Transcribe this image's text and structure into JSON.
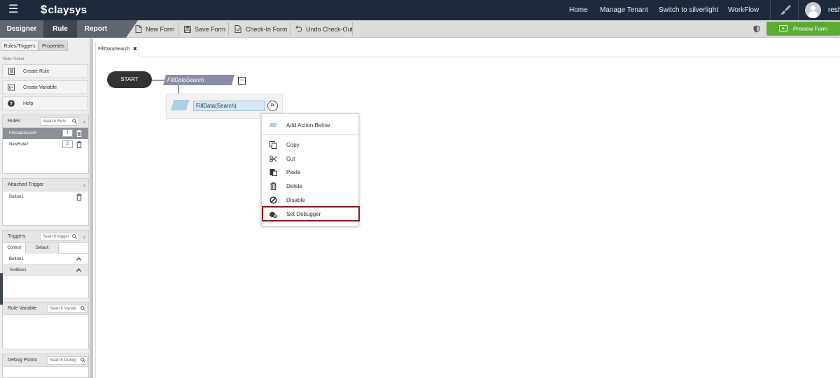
{
  "topbar": {
    "brand": "claysys",
    "nav": [
      "Home",
      "Manage Tenant",
      "Switch to silverlight",
      "WorkFlow"
    ],
    "username": "resh"
  },
  "toolbar": {
    "modes": [
      "Designer",
      "Rule",
      "Report"
    ],
    "active_mode": "Rule",
    "actions": [
      "New Form",
      "Save Form",
      "Check-In Form",
      "Undo Check-Out"
    ],
    "preview_label": "Preview Form",
    "accent_color": "#5aac32"
  },
  "left": {
    "tabs": [
      "Rules/Triggers",
      "Properties"
    ],
    "rule_picker_label": "Rule Picker",
    "picker_buttons": [
      "Create Rule",
      "Create Variable",
      "Help"
    ],
    "rules_panel": {
      "title": "Rules",
      "search_placeholder": "Search Rule",
      "items": [
        {
          "name": "FillDataSearch",
          "order": "1"
        },
        {
          "name": "NewRule2",
          "order": "2"
        }
      ]
    },
    "attached_trigger": {
      "title": "Attached Trigger",
      "items": [
        "Button1"
      ]
    },
    "triggers_panel": {
      "title": "Triggers",
      "search_placeholder": "Search trigger",
      "tabs": [
        "Control",
        "Default"
      ],
      "items": [
        "Button1",
        "TextBox1"
      ]
    },
    "rule_variable": {
      "title": "Rule Variable",
      "search_placeholder": "Search Variab"
    },
    "debug_points": {
      "title": "Debug Points",
      "search_placeholder": "Search Debug"
    }
  },
  "canvas": {
    "doc_tab": "FillDataSearch",
    "start_label": "START",
    "rule_label": "FillDataSearch",
    "action_label": "FillData(Search)",
    "fx_label": "fx"
  },
  "context_menu": {
    "items": [
      "Add Action Below",
      "Copy",
      "Cut",
      "Paste",
      "Delete",
      "Disable",
      "Set Debugger"
    ],
    "highlight_color": "#8b1a1a"
  }
}
